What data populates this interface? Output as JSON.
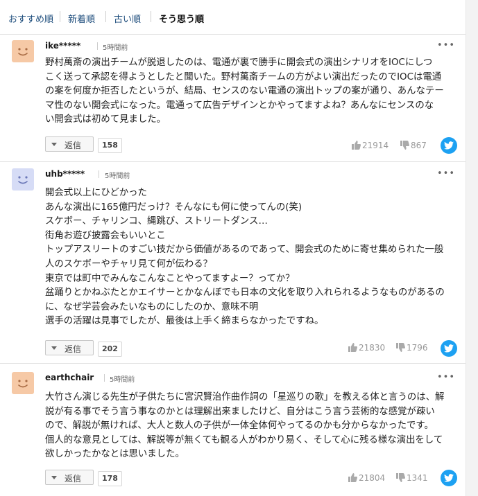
{
  "sort_tabs": [
    "おすすめ順",
    "新着順",
    "古い順",
    "そう思う順"
  ],
  "comments": [
    {
      "user": "ike*****",
      "time": "5時間前",
      "avatar_color": "#f6c9a6",
      "body": [
        "野村萬斎の演出チームが脱退したのは、電通が裏で勝手に開会式の演出シナリオをIOCにしつ",
        "こく送って承認を得ようとしたと聞いた。野村萬斎チームの方がよい演出だったのでIOCは電通",
        "の案を何度か拒否したというが、結局、センスのない電通の演出トップの案が通り、あんなテー",
        "マ性のない開会式になった。電通って広告デザインとかやってますよね？あんなにセンスのな",
        "い開会式は初めて見ました。"
      ],
      "reply_label": "返信",
      "reply_count": "158",
      "likes": "21914",
      "dislikes": "867"
    },
    {
      "user": "uhb*****",
      "time": "5時間前",
      "avatar_color": "#d6dcf6",
      "body": [
        "開会式以上にひどかった",
        "あんな演出に165億円だっけ？そんなにも何に使ってんの(笑)",
        "スケボー、チャリンコ、縄跳び、ストリートダンス…",
        "街角お遊び披露会もいいとこ",
        "トップアスリートのすごい技だから価値があるのであって、開会式のために寄せ集められた一般",
        "人のスケボーやチャリ見て何が伝わる？",
        "東京では町中でみんなこんなことやってますよー？ってか？",
        "盆踊りとかねぶたとかエイサーとかなんぼでも日本の文化を取り入れられるようなものがあるの",
        "に、なぜ学芸会みたいなものにしたのか、意味不明",
        "選手の活躍は見事でしたが、最後は上手く締まらなかったですね。"
      ],
      "reply_label": "返信",
      "reply_count": "202",
      "likes": "21830",
      "dislikes": "1796"
    },
    {
      "user": "earthchair",
      "time": "5時間前",
      "avatar_color": "#f6c9a6",
      "body": [
        "大竹さん演じる先生が子供たちに宮沢賢治作曲作詞の「星巡りの歌」を教える体と言うのは、解",
        "説が有る事でそう言う事なのかとは理解出来ましたけど、自分はこう言う芸術的な感覚が疎い",
        "ので、解説が無ければ、大人と数人の子供が一体全体何やってるのかも分からなかったです。",
        "個人的な意見としては、解説等が無くても観る人がわかり易く、そして心に残る様な演出をして",
        "欲しかったかなとは思いました。"
      ],
      "reply_label": "返信",
      "reply_count": "178",
      "likes": "21804",
      "dislikes": "1341"
    }
  ]
}
